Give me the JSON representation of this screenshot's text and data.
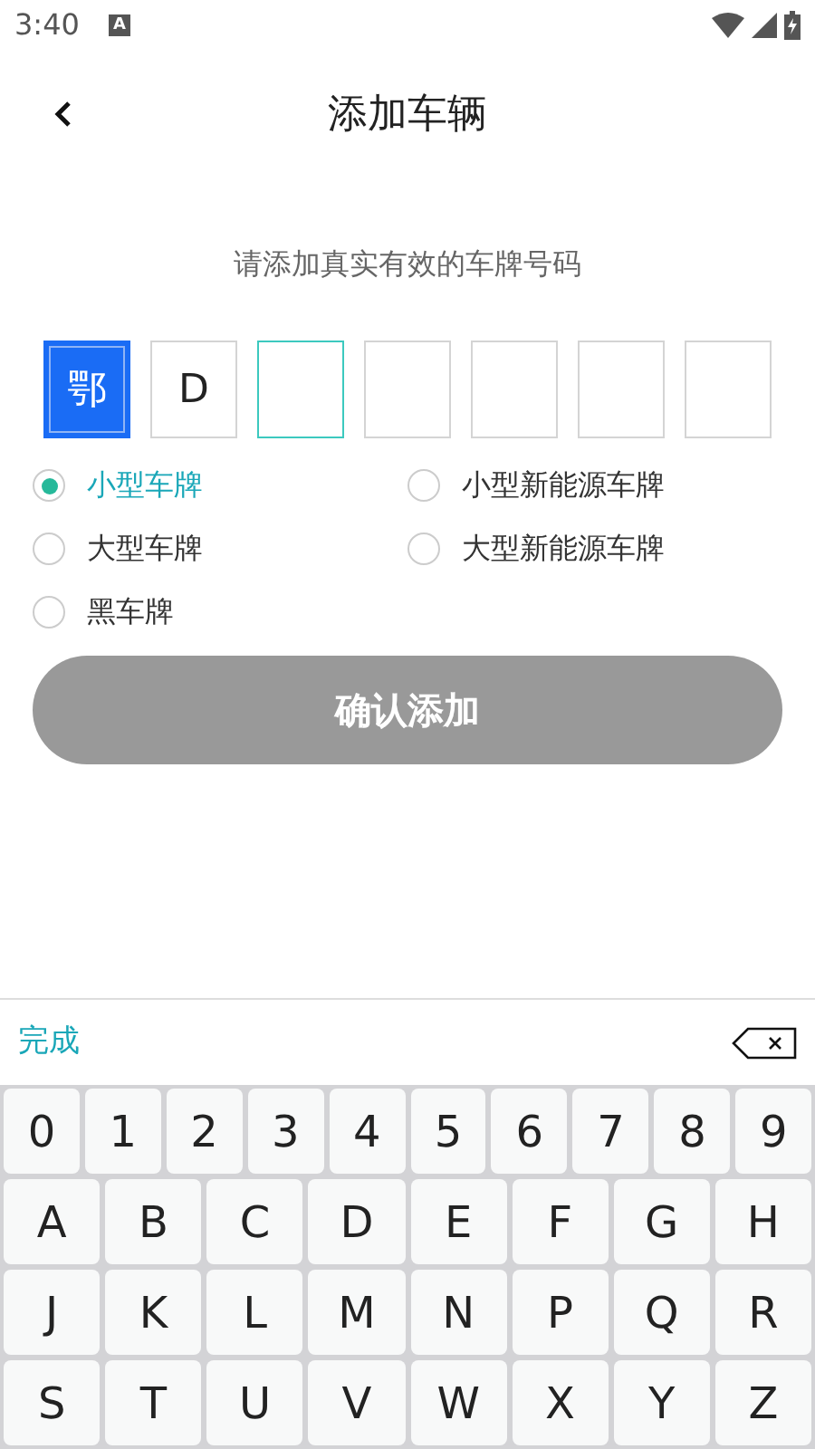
{
  "status_bar": {
    "time": "3:40",
    "notification": "A"
  },
  "header": {
    "title": "添加车辆"
  },
  "prompt": "请添加真实有效的车牌号码",
  "plate_cells": [
    {
      "value": "鄂",
      "selected": true,
      "focused": false
    },
    {
      "value": "D",
      "selected": false,
      "focused": false
    },
    {
      "selected": false,
      "focused": true
    },
    {
      "selected": false,
      "focused": false
    },
    {
      "selected": false,
      "focused": false
    },
    {
      "selected": false,
      "focused": false
    },
    {
      "selected": false,
      "focused": false
    }
  ],
  "plate_types": [
    {
      "label": "小型车牌",
      "selected": true
    },
    {
      "label": "小型新能源车牌",
      "selected": false
    },
    {
      "label": "大型车牌",
      "selected": false
    },
    {
      "label": "大型新能源车牌",
      "selected": false
    },
    {
      "label": "黑车牌",
      "selected": false
    }
  ],
  "confirm_button": {
    "label": "确认添加",
    "disabled": true
  },
  "keyboard": {
    "done": "完成",
    "number_row": [
      "0",
      "1",
      "2",
      "3",
      "4",
      "5",
      "6",
      "7",
      "8",
      "9"
    ],
    "letter_rows": [
      [
        "A",
        "B",
        "C",
        "D",
        "E",
        "F",
        "G",
        "H"
      ],
      [
        "J",
        "K",
        "L",
        "M",
        "N",
        "P",
        "Q",
        "R"
      ],
      [
        "S",
        "T",
        "U",
        "V",
        "W",
        "X",
        "Y",
        "Z"
      ]
    ]
  }
}
